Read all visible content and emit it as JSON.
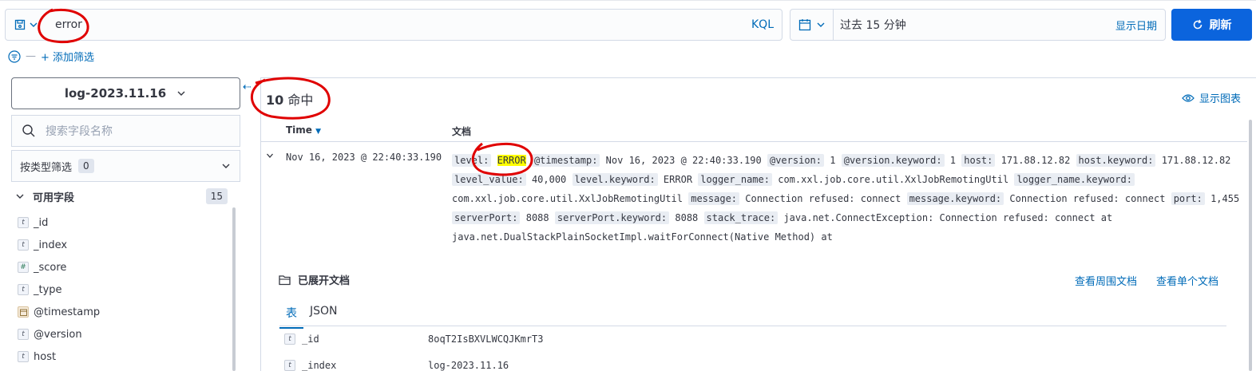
{
  "query": {
    "text": "error",
    "language": "KQL"
  },
  "time": {
    "range": "过去 15 分钟",
    "show_dates": "显示日期"
  },
  "refresh_label": "刷新",
  "filter": {
    "add_label": "+ 添加筛选"
  },
  "sidebar": {
    "index_pattern": "log-2023.11.16",
    "search_placeholder": "搜索字段名称",
    "type_filter_label": "按类型筛选",
    "type_filter_count": "0",
    "available_label": "可用字段",
    "available_count": "15",
    "fields": [
      {
        "type": "t",
        "name": "_id"
      },
      {
        "type": "t",
        "name": "_index"
      },
      {
        "type": "#",
        "name": "_score"
      },
      {
        "type": "t",
        "name": "_type"
      },
      {
        "type": "date",
        "name": "@timestamp"
      },
      {
        "type": "t",
        "name": "@version"
      },
      {
        "type": "t",
        "name": "host"
      }
    ]
  },
  "main": {
    "hits_count": "10",
    "hits_label": "命中",
    "show_chart": "显示图表",
    "columns": {
      "time": "Time",
      "document": "文档"
    },
    "row": {
      "time": "Nov 16, 2023 @ 22:40:33.190",
      "fields": [
        {
          "k": "level:",
          "v": "ERROR",
          "highlight": true
        },
        {
          "k": "@timestamp:",
          "v": "Nov 16, 2023 @ 22:40:33.190"
        },
        {
          "k": "@version:",
          "v": "1"
        },
        {
          "k": "@version.keyword:",
          "v": "1"
        },
        {
          "k": "host:",
          "v": "171.88.12.82"
        },
        {
          "k": "host.keyword:",
          "v": "171.88.12.82"
        },
        {
          "k": "level_value:",
          "v": "40,000"
        },
        {
          "k": "level.keyword:",
          "v": "ERROR"
        },
        {
          "k": "logger_name:",
          "v": "com.xxl.job.core.util.XxlJobRemotingUtil"
        },
        {
          "k": "logger_name.keyword:",
          "v": "com.xxl.job.core.util.XxlJobRemotingUtil"
        },
        {
          "k": "message:",
          "v": "Connection refused: connect"
        },
        {
          "k": "message.keyword:",
          "v": "Connection refused: connect"
        },
        {
          "k": "port:",
          "v": "1,455"
        },
        {
          "k": "serverPort:",
          "v": "8088"
        },
        {
          "k": "serverPort.keyword:",
          "v": "8088"
        },
        {
          "k": "stack_trace:",
          "v": "java.net.ConnectException: Connection refused: connect at java.net.DualStackPlainSocketImpl.waitForConnect(Native Method) at"
        }
      ]
    },
    "expanded": {
      "title": "已展开文档",
      "view_surrounding": "查看周围文档",
      "view_single": "查看单个文档",
      "tabs": [
        "表",
        "JSON"
      ],
      "rows": [
        {
          "type": "t",
          "name": "_id",
          "value": "8oqT2IsBXVLWCQJKmrT3"
        },
        {
          "type": "t",
          "name": "_index",
          "value": "log-2023.11.16"
        }
      ]
    }
  },
  "colors": {
    "accent": "#006bb8",
    "button": "#0b64dd",
    "highlight": "#ffff00",
    "annotation": "#e00000"
  }
}
